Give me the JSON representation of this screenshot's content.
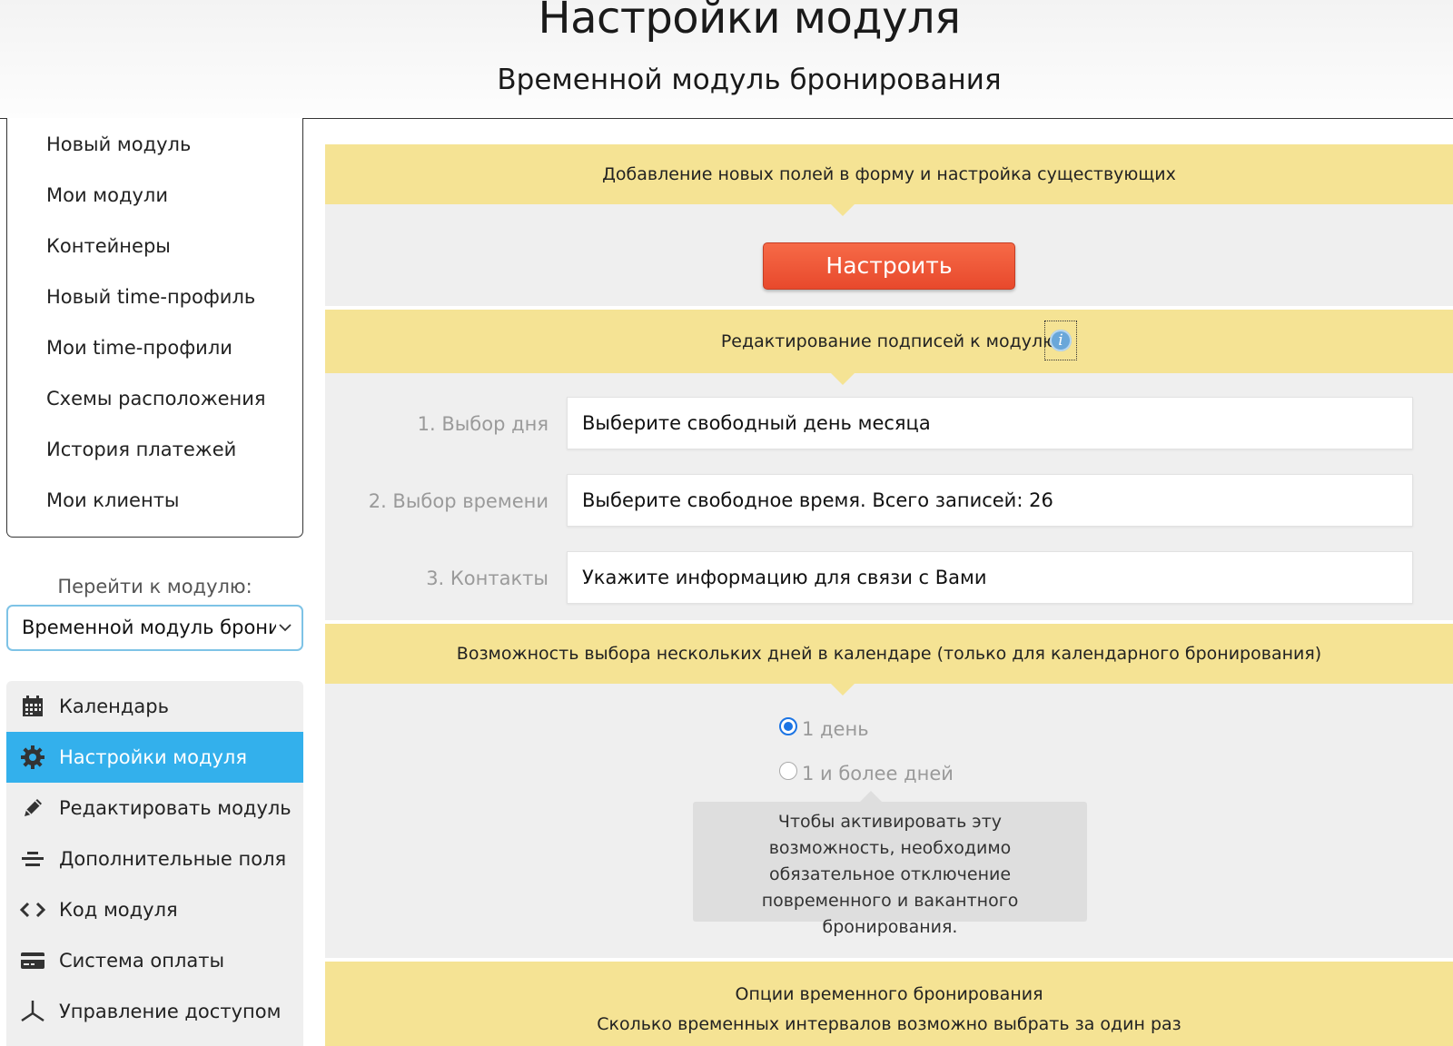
{
  "header": {
    "title": "Настройки модуля",
    "subtitle": "Временной модуль бронирования"
  },
  "nav": {
    "items": [
      {
        "label": "Новый модуль"
      },
      {
        "label": "Мои модули"
      },
      {
        "label": "Контейнеры"
      },
      {
        "label": "Новый time-профиль"
      },
      {
        "label": "Мои time-профили"
      },
      {
        "label": "Схемы расположения"
      },
      {
        "label": "История платежей"
      },
      {
        "label": "Мои клиенты"
      }
    ]
  },
  "goto": {
    "label": "Перейти к модулю:",
    "selected": "Временной модуль бронирования"
  },
  "menu": {
    "items": [
      {
        "label": "Календарь",
        "icon": "calendar-icon",
        "active": false
      },
      {
        "label": "Настройки модуля",
        "icon": "gear-icon",
        "active": true
      },
      {
        "label": "Редактировать модуль",
        "icon": "pencil-icon",
        "active": false
      },
      {
        "label": "Дополнительные поля",
        "icon": "fields-icon",
        "active": false
      },
      {
        "label": "Код модуля",
        "icon": "code-icon",
        "active": false
      },
      {
        "label": "Система оплаты",
        "icon": "credit-card-icon",
        "active": false
      },
      {
        "label": "Управление доступом",
        "icon": "access-icon",
        "active": false
      }
    ]
  },
  "sections": {
    "fields": {
      "title": "Добавление новых полей в форму и настройка существующих",
      "button": "Настроить"
    },
    "captions": {
      "title": "Редактирование подписей к модулю",
      "rows": [
        {
          "label": "1. Выбор дня",
          "value": "Выберите свободный день месяца"
        },
        {
          "label": "2. Выбор времени",
          "value": "Выберите свободное время. Всего записей: 26"
        },
        {
          "label": "3. Контакты",
          "value": "Укажите информацию для связи с Вами"
        }
      ]
    },
    "multiday": {
      "title": "Возможность выбора нескольких дней в календаре (только для календарного бронирования)",
      "options": [
        {
          "label": "1 день",
          "checked": true
        },
        {
          "label": "1 и более дней",
          "checked": false
        }
      ],
      "tooltip": "Чтобы активировать эту возможность, необходимо обязательное отключение повременного и вакантного бронирования."
    },
    "time_options": {
      "title": "Опции временного бронирования",
      "subtitle": "Сколько временных интервалов возможно выбрать за один раз"
    }
  },
  "colors": {
    "accent": "#33b0ec",
    "band": "#f5e394",
    "button": "#ef5a3a"
  }
}
